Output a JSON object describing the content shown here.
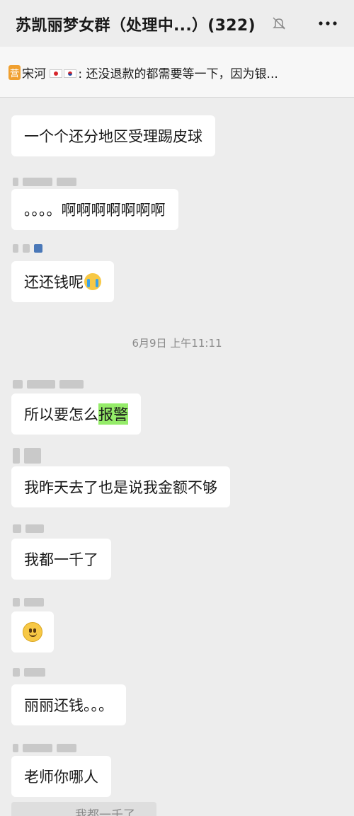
{
  "header": {
    "title": "苏凯丽梦女群（处理中...）(322)",
    "mute_icon": "bell-off-icon",
    "more_icon": "more-icon"
  },
  "pinned": {
    "badge": "营",
    "sender": "宋河",
    "text": ": 还没退款的都需要等一下，因为银..."
  },
  "messages": [
    {
      "text": "一个个还分地区受理踢皮球"
    },
    {
      "text": "。。。。啊啊啊啊啊啊啊"
    },
    {
      "text": "还还钱呢"
    },
    {
      "text_before": "所以要怎么",
      "highlight": "报警"
    },
    {
      "text": "我昨天去了也是说我金额不够"
    },
    {
      "text": "我都一千了"
    },
    {
      "text": "丽丽还钱。。。"
    },
    {
      "text": "老师你哪人"
    }
  ],
  "timestamp": "6月9日 上午11:11",
  "quote": {
    "text": "我都一千了"
  }
}
